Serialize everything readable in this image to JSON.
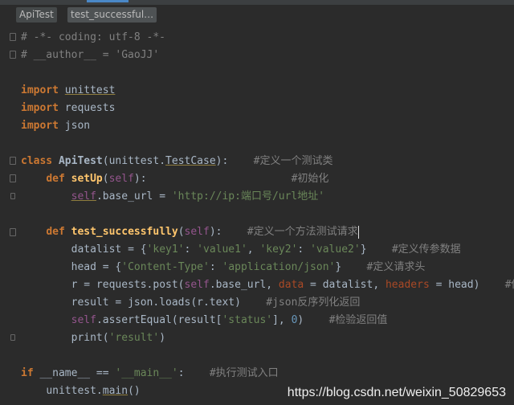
{
  "breadcrumb": [
    "ApiTest",
    "test_successful…"
  ],
  "code": {
    "l1": "# -*- coding: utf-8 -*-",
    "l2": "# __author__ = 'GaoJJ'",
    "import_kw": "import",
    "mod_unittest": "unittest",
    "mod_requests": "requests",
    "mod_json": "json",
    "class_kw": "class",
    "class_name": "ApiTest",
    "class_base_pre": "(unittest.",
    "class_base": "TestCase",
    "class_base_post": "):",
    "class_cmt": "#定义一个测试类",
    "def_kw": "def",
    "setup_name": "setUp",
    "self": "self",
    "setup_post": "):",
    "setup_cmt": "#初始化",
    "base_attr": ".base_url = ",
    "base_url_value": "'http://ip:端口号/url地址'",
    "test_name": "test_successfully",
    "test_cmt": "#定义一个方法测试请求",
    "datalist_pre": "datalist = {",
    "key1": "'key1'",
    "value1": "'value1'",
    "key2": "'key2'",
    "value2": "'value2'",
    "datalist_post": "}",
    "datalist_cmt": "#定义传参数据",
    "head_pre": "head = {",
    "ct_key": "'Content-Type'",
    "ct_val": "'application/json'",
    "head_post": "}",
    "head_cmt": "#定义请求头",
    "r_pre": "r = requests.post(",
    "r_mid": ".base_url, ",
    "data_kw": "data",
    "data_mid": " = datalist, ",
    "headers_kw": "headers",
    "headers_post": " = head)",
    "r_cmt": "#传参",
    "result_line": "result = json.loads(r.text)",
    "result_cmt": "#json反序列化返回",
    "assert_mid": ".assertEqual(result[",
    "status_str": "'status'",
    "assert_sep": "], ",
    "zero": "0",
    "assert_post": ")",
    "assert_cmt": "#检验返回值",
    "print_pre": "print(",
    "result_str": "'result'",
    "print_post": ")",
    "if_kw": "if",
    "name_dunder": "__name__",
    "eq": " == ",
    "main_str": "'__main__'",
    "colon": ":",
    "if_cmt": "#执行测试入口",
    "main_call_pre": "unittest.",
    "main_call_fn": "main",
    "main_call_post": "()"
  },
  "watermark": "https://blog.csdn.net/weixin_50829653"
}
